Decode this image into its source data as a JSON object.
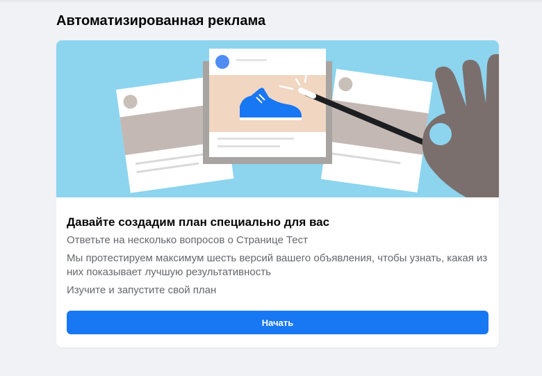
{
  "page": {
    "title": "Автоматизированная реклама"
  },
  "card": {
    "hero_icons": [
      "ad-preview-cards-illustration",
      "sneaker-icon",
      "magic-wand-icon",
      "hand-icon"
    ],
    "heading": "Давайте создадим план специально для вас",
    "lines": [
      "Ответьте на несколько вопросов о Странице Тест",
      "Мы протестируем максимум шесть версий вашего объявления, чтобы узнать, какая из них показывает лучшую результативность",
      "Изучите и запустите свой план"
    ],
    "start_label": "Начать"
  },
  "colors": {
    "background": "#f0f2f5",
    "hero_background": "#8dd4ef",
    "accent": "#1877f2",
    "text_primary": "#050505",
    "text_secondary": "#65676b"
  }
}
